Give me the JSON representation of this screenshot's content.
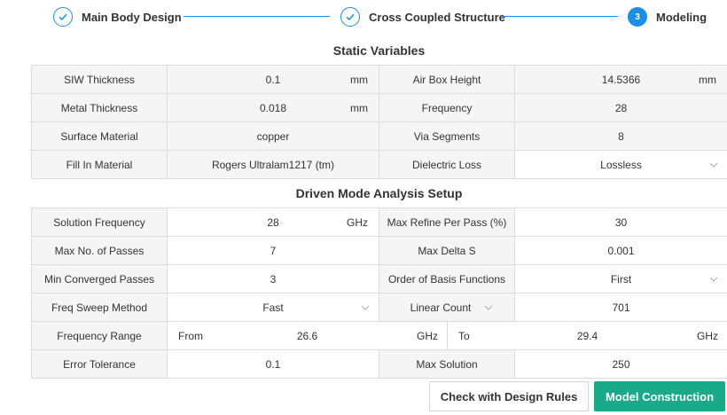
{
  "stepper": {
    "steps": [
      {
        "label": "Main Body Design",
        "state": "done"
      },
      {
        "label": "Cross Coupled Structure",
        "state": "done"
      },
      {
        "label": "Modeling",
        "state": "active",
        "number": "3"
      }
    ],
    "accent_color": "#1a8fe3"
  },
  "static": {
    "title": "Static Variables",
    "rows": [
      {
        "l1": "SIW Thickness",
        "v1": "0.1",
        "u1": "mm",
        "l2": "Air Box Height",
        "v2": "14.5366",
        "u2": "mm"
      },
      {
        "l1": "Metal Thickness",
        "v1": "0.018",
        "u1": "mm",
        "l2": "Frequency",
        "v2": "28"
      },
      {
        "l1": "Surface Material",
        "v1": "copper",
        "l2": "Via Segments",
        "v2": "8"
      },
      {
        "l1": "Fill In Material",
        "v1": "Rogers Ultralam1217 (tm)",
        "l2": "Dielectric Loss",
        "v2": "Lossless"
      }
    ]
  },
  "driven": {
    "title": "Driven Mode Analysis Setup",
    "rows": [
      {
        "l1": "Solution Frequency",
        "v1": "28",
        "u1": "GHz",
        "l2": "Max Refine Per Pass (%)",
        "v2": "30"
      },
      {
        "l1": "Max No. of Passes",
        "v1": "7",
        "l2": "Max Delta S",
        "v2": "0.001"
      },
      {
        "l1": "Min Converged Passes",
        "v1": "3",
        "l2": "Order of Basis Functions",
        "v2": "First"
      },
      {
        "l1": "Freq Sweep Method",
        "v1": "Fast",
        "l2": "Linear Count",
        "v2": "701"
      },
      {
        "l1": "Error Tolerance",
        "v1": "0.1",
        "l2": "Max Solution",
        "v2": "250"
      }
    ],
    "frequency_range": {
      "label": "Frequency Range",
      "from_label": "From",
      "from_value": "26.6",
      "from_unit": "GHz",
      "to_label": "To",
      "to_value": "29.4",
      "to_unit": "GHz"
    }
  },
  "buttons": {
    "check": "Check with Design Rules",
    "construct": "Model Construction",
    "construct_color": "#1aaa8a"
  }
}
